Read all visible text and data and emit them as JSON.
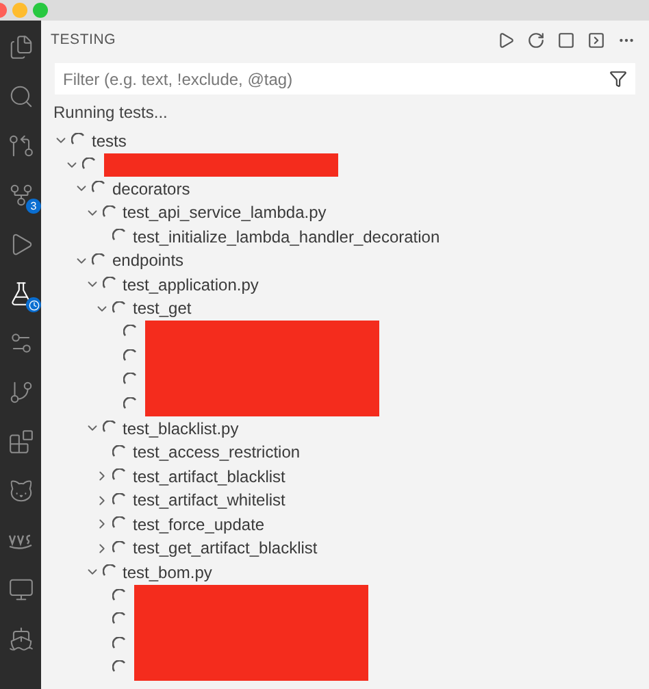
{
  "activity_bar": [
    {
      "kind": "files",
      "selected": false
    },
    {
      "kind": "search",
      "selected": false
    },
    {
      "kind": "source-control-panel",
      "selected": false
    },
    {
      "kind": "source-control",
      "selected": false,
      "badge": "3"
    },
    {
      "kind": "run",
      "selected": false
    },
    {
      "kind": "testing",
      "selected": true
    },
    {
      "kind": "branch-settings",
      "selected": false
    },
    {
      "kind": "branch",
      "selected": false
    },
    {
      "kind": "extensions",
      "selected": false
    },
    {
      "kind": "fox",
      "selected": false
    },
    {
      "kind": "aws",
      "selected": false
    },
    {
      "kind": "remote",
      "selected": false
    },
    {
      "kind": "whale",
      "selected": false
    }
  ],
  "panel": {
    "title": "TESTING",
    "filter": {
      "placeholder": "Filter (e.g. text, !exclude, @tag)"
    },
    "status": "Running tests..."
  },
  "tree": [
    {
      "label": "tests",
      "expanded": true,
      "children": [
        {
          "kind": "redacted",
          "expanded": true,
          "children": [
            {
              "label": "decorators",
              "expanded": true,
              "children": [
                {
                  "label": "test_api_service_lambda.py",
                  "expanded": true,
                  "children": [
                    {
                      "label": "test_initialize_lambda_handler_decoration"
                    }
                  ]
                }
              ]
            },
            {
              "label": "endpoints",
              "expanded": true,
              "children": [
                {
                  "label": "test_application.py",
                  "expanded": true,
                  "children": [
                    {
                      "label": "test_get",
                      "expanded": true,
                      "children": [
                        {
                          "kind": "redacted"
                        },
                        {
                          "kind": "redacted"
                        },
                        {
                          "kind": "redacted"
                        },
                        {
                          "kind": "redacted"
                        }
                      ]
                    }
                  ]
                },
                {
                  "label": "test_blacklist.py",
                  "expanded": true,
                  "children": [
                    {
                      "label": "test_access_restriction"
                    },
                    {
                      "label": "test_artifact_blacklist",
                      "expanded": false
                    },
                    {
                      "label": "test_artifact_whitelist",
                      "expanded": false
                    },
                    {
                      "label": "test_force_update",
                      "expanded": false
                    },
                    {
                      "label": "test_get_artifact_blacklist",
                      "expanded": false
                    }
                  ]
                },
                {
                  "label": "test_bom.py",
                  "expanded": true,
                  "children": [
                    {
                      "kind": "redacted"
                    },
                    {
                      "kind": "redacted"
                    },
                    {
                      "kind": "redacted"
                    },
                    {
                      "kind": "redacted"
                    }
                  ]
                }
              ]
            }
          ]
        }
      ]
    }
  ]
}
